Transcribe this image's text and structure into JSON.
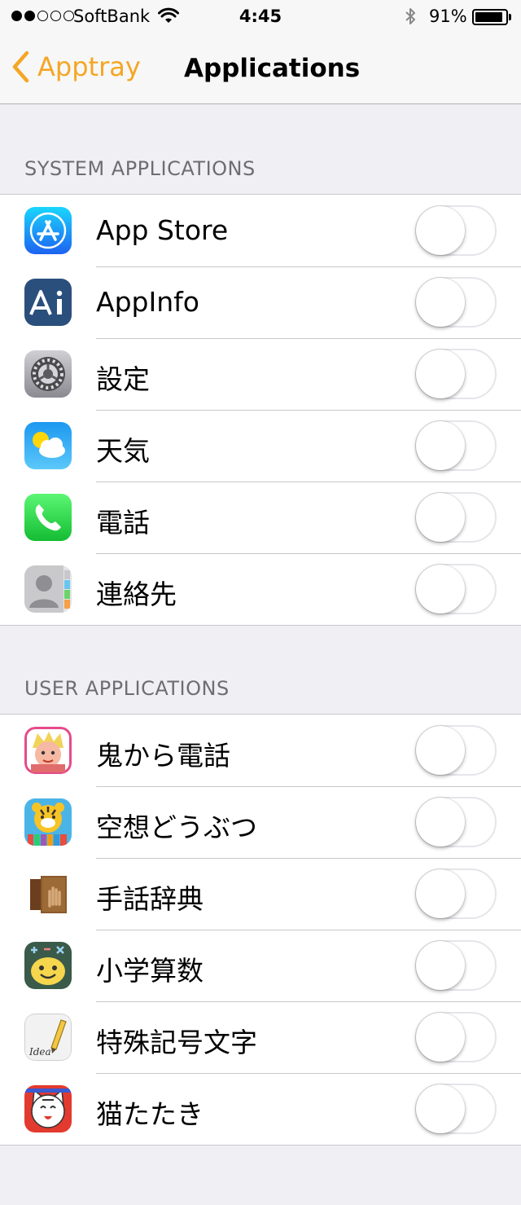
{
  "status_bar": {
    "carrier": "SoftBank",
    "time": "4:45",
    "battery_percent": "91%",
    "signal_bars_filled": 2,
    "signal_bars_total": 5,
    "battery_level": 0.91
  },
  "nav": {
    "back_label": "Apptray",
    "title": "Applications",
    "accent_color": "#f5a623"
  },
  "system_section": {
    "header": "SYSTEM APPLICATIONS",
    "apps": [
      {
        "name": "App Store",
        "icon": "app-store-icon",
        "enabled": false
      },
      {
        "name": "AppInfo",
        "icon": "appinfo-icon",
        "enabled": false
      },
      {
        "name": "設定",
        "icon": "settings-gear-icon",
        "enabled": false
      },
      {
        "name": "天気",
        "icon": "weather-icon",
        "enabled": false
      },
      {
        "name": "電話",
        "icon": "phone-icon",
        "enabled": false
      },
      {
        "name": "連絡先",
        "icon": "contacts-icon",
        "enabled": false
      }
    ]
  },
  "user_section": {
    "header": "USER APPLICATIONS",
    "apps": [
      {
        "name": "鬼から電話",
        "icon": "oni-icon",
        "enabled": false
      },
      {
        "name": "空想どうぶつ",
        "icon": "tiger-icon",
        "enabled": false
      },
      {
        "name": "手話辞典",
        "icon": "book-hand-icon",
        "enabled": false
      },
      {
        "name": "小学算数",
        "icon": "math-smiley-icon",
        "enabled": false
      },
      {
        "name": "特殊記号文字",
        "icon": "idea-pencil-icon",
        "enabled": false
      },
      {
        "name": "猫たたき",
        "icon": "cat-icon",
        "enabled": false
      }
    ]
  }
}
